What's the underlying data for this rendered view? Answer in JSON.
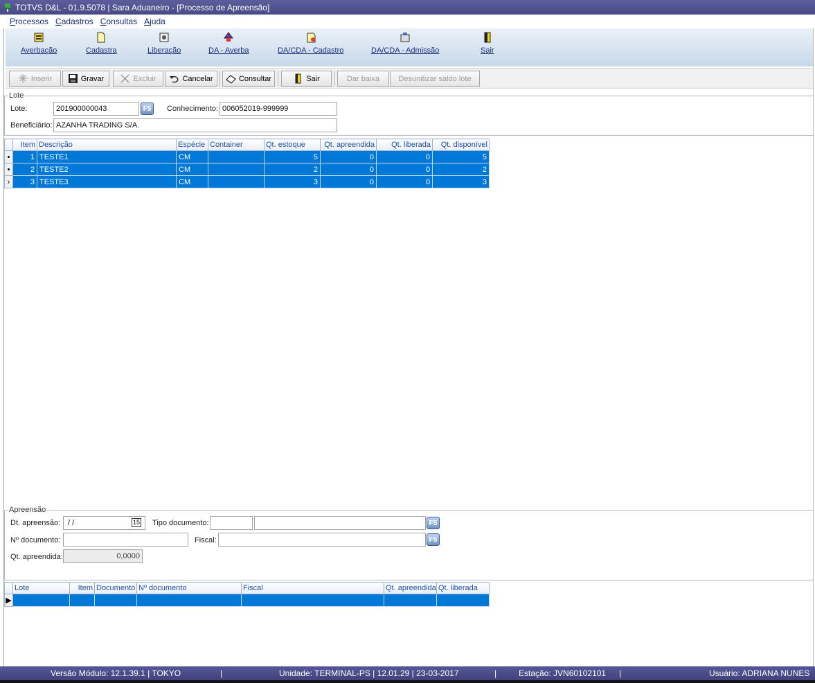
{
  "window": {
    "title": "TOTVS D&L - 01.9.5078 | Sara Aduaneiro - [Processo de Apreensão]"
  },
  "menu": [
    "Processos",
    "Cadastros",
    "Consultas",
    "Ajuda"
  ],
  "toolstrip": [
    {
      "label": "Averbação",
      "icon": "averbacao-icon"
    },
    {
      "label": "Cadastra",
      "icon": "cadastra-icon"
    },
    {
      "label": "Liberação",
      "icon": "liberacao-icon"
    },
    {
      "label": "DA - Averba",
      "icon": "da-averba-icon"
    },
    {
      "label": "DA/CDA - Cadastro",
      "icon": "cda-cadastro-icon"
    },
    {
      "label": "DA/CDA - Admissão",
      "icon": "cda-admissao-icon"
    },
    {
      "label": "Sair",
      "icon": "exit-door-icon"
    }
  ],
  "buttons": {
    "inserir": "Inserir",
    "gravar": "Gravar",
    "excluir": "Excluir",
    "cancelar": "Cancelar",
    "consultar": "Consultar",
    "sair": "Sair",
    "dar_baixa": "Dar baixa",
    "desunitizar": "Desunitizar saldo lote"
  },
  "lote_group": {
    "title": "Lote",
    "lote_label": "Lote:",
    "lote_value": "201900000043",
    "conhecimento_label": "Conhecimento:",
    "conhecimento_value": "006052019-999999",
    "beneficiario_label": "Beneficiário:",
    "beneficiario_value": "AZANHA TRADING S/A.",
    "f5": "F5"
  },
  "items_table": {
    "columns": [
      "Item",
      "Descrição",
      "Espécie",
      "Container",
      "Qt. estoque",
      "Qt. apreendida",
      "Qt. liberada",
      "Qt. disponível"
    ],
    "rows": [
      {
        "item": "1",
        "descricao": "TESTE1",
        "especie": "CM",
        "container": "",
        "qt_estoque": "5",
        "qt_apreendida": "0",
        "qt_liberada": "0",
        "qt_disponivel": "5"
      },
      {
        "item": "2",
        "descricao": "TESTE2",
        "especie": "CM",
        "container": "",
        "qt_estoque": "2",
        "qt_apreendida": "0",
        "qt_liberada": "0",
        "qt_disponivel": "2"
      },
      {
        "item": "3",
        "descricao": "TESTE3",
        "especie": "CM",
        "container": "",
        "qt_estoque": "3",
        "qt_apreendida": "0",
        "qt_liberada": "0",
        "qt_disponivel": "3"
      }
    ]
  },
  "apreensao_group": {
    "title": "Apreensão",
    "dt_label": "Dt. apreensão:",
    "dt_value": " / /",
    "calendar": "15",
    "tipo_label": "Tipo documento:",
    "ndoc_label": "Nº documento:",
    "fiscal_label": "Fiscal:",
    "qt_label": "Qt. apreendida:",
    "qt_value": "0,0000",
    "f5": "F5"
  },
  "apreensao_table": {
    "columns": [
      "Lote",
      "Item",
      "Documento",
      "Nº documento",
      "Fiscal",
      "Qt. apreendida",
      "Qt. liberada"
    ]
  },
  "status": {
    "versao": "Versão Módulo:  12.1.39.1  |  TOKYO",
    "unidade": "Unidade: TERMINAL-PS | 12.01.29 | 23-03-2017",
    "estacao": "Estação: JVN60102101",
    "usuario": "Usuário: ADRIANA NUNES",
    "sep": "|"
  },
  "colors": {
    "selection": "#0078d7",
    "title": "#4f5090",
    "header_text": "#1d4fb0"
  }
}
